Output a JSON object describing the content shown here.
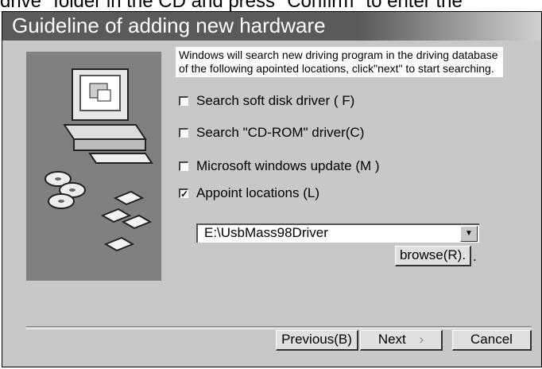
{
  "background_text": "drive\" folder in the CD and press \"Confirm\" to enter the",
  "window": {
    "title": "Guideline of adding new hardware"
  },
  "info_text": "Windows will search new driving program in the driving database of the following apointed locations, click\"next\" to start searching.",
  "options": [
    {
      "label": "Search soft disk driver ( F)",
      "checked": false
    },
    {
      "label": "Search \"CD-ROM\" driver(C)",
      "checked": false
    },
    {
      "label": "Microsoft windows update (M )",
      "checked": false
    },
    {
      "label": "Appoint locations (L)",
      "checked": true
    }
  ],
  "location": {
    "value": "E:\\UsbMass98Driver",
    "dropdown_icon": "chevron-down-icon"
  },
  "browse_label": "browse(R).",
  "browse_suffix": ".",
  "buttons": {
    "previous": "Previous(B)",
    "next": "Next",
    "next_arrow": "›",
    "cancel": "Cancel"
  },
  "colors": {
    "window_bg": "#c8c8c8",
    "titlebar": "#5a5a5a",
    "illustration_bg": "#808080"
  }
}
